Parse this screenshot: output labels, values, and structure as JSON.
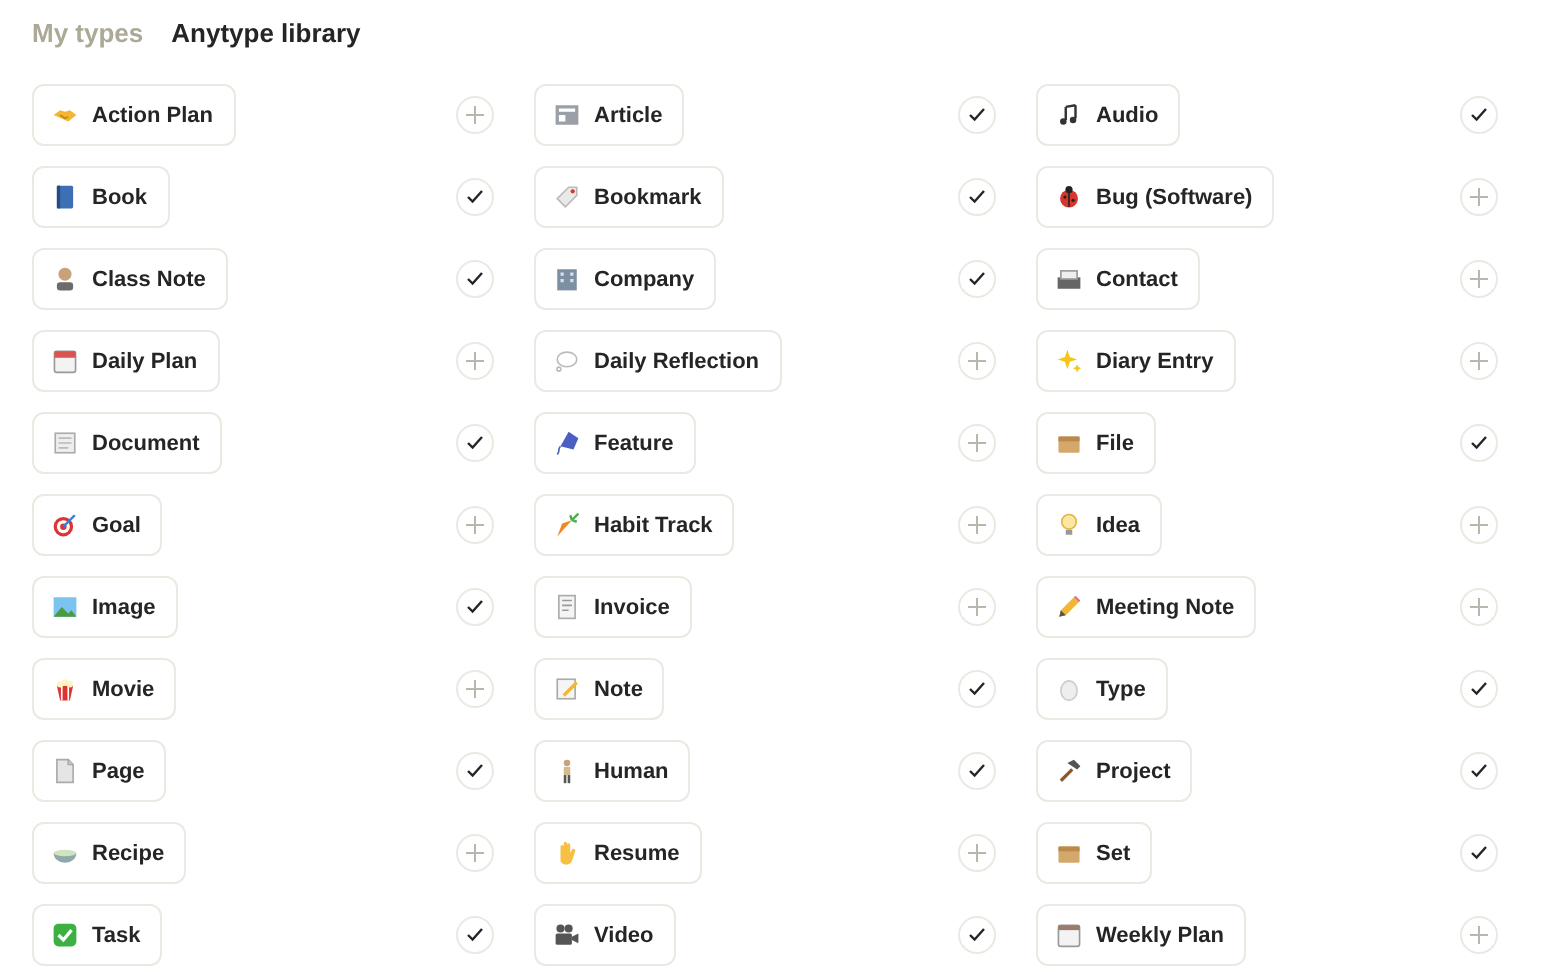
{
  "tabs": [
    {
      "label": "My types",
      "selected": false
    },
    {
      "label": "Anytype library",
      "selected": true
    }
  ],
  "types": [
    {
      "label": "Action Plan",
      "added": false
    },
    {
      "label": "Article",
      "added": true
    },
    {
      "label": "Audio",
      "added": true
    },
    {
      "label": "Book",
      "added": true
    },
    {
      "label": "Bookmark",
      "added": true
    },
    {
      "label": "Bug (Software)",
      "added": false
    },
    {
      "label": "Class Note",
      "added": true
    },
    {
      "label": "Company",
      "added": true
    },
    {
      "label": "Contact",
      "added": false
    },
    {
      "label": "Daily Plan",
      "added": false
    },
    {
      "label": "Daily Reflection",
      "added": false
    },
    {
      "label": "Diary Entry",
      "added": false
    },
    {
      "label": "Document",
      "added": true
    },
    {
      "label": "Feature",
      "added": false
    },
    {
      "label": "File",
      "added": true
    },
    {
      "label": "Goal",
      "added": false
    },
    {
      "label": "Habit Track",
      "added": false
    },
    {
      "label": "Idea",
      "added": false
    },
    {
      "label": "Image",
      "added": true
    },
    {
      "label": "Invoice",
      "added": false
    },
    {
      "label": "Meeting Note",
      "added": false
    },
    {
      "label": "Movie",
      "added": false
    },
    {
      "label": "Note",
      "added": true
    },
    {
      "label": "Type",
      "added": true
    },
    {
      "label": "Page",
      "added": true
    },
    {
      "label": "Human",
      "added": true
    },
    {
      "label": "Project",
      "added": true
    },
    {
      "label": "Recipe",
      "added": false
    },
    {
      "label": "Resume",
      "added": false
    },
    {
      "label": "Set",
      "added": true
    },
    {
      "label": "Task",
      "added": true
    },
    {
      "label": "Video",
      "added": true
    },
    {
      "label": "Weekly Plan",
      "added": false
    }
  ]
}
